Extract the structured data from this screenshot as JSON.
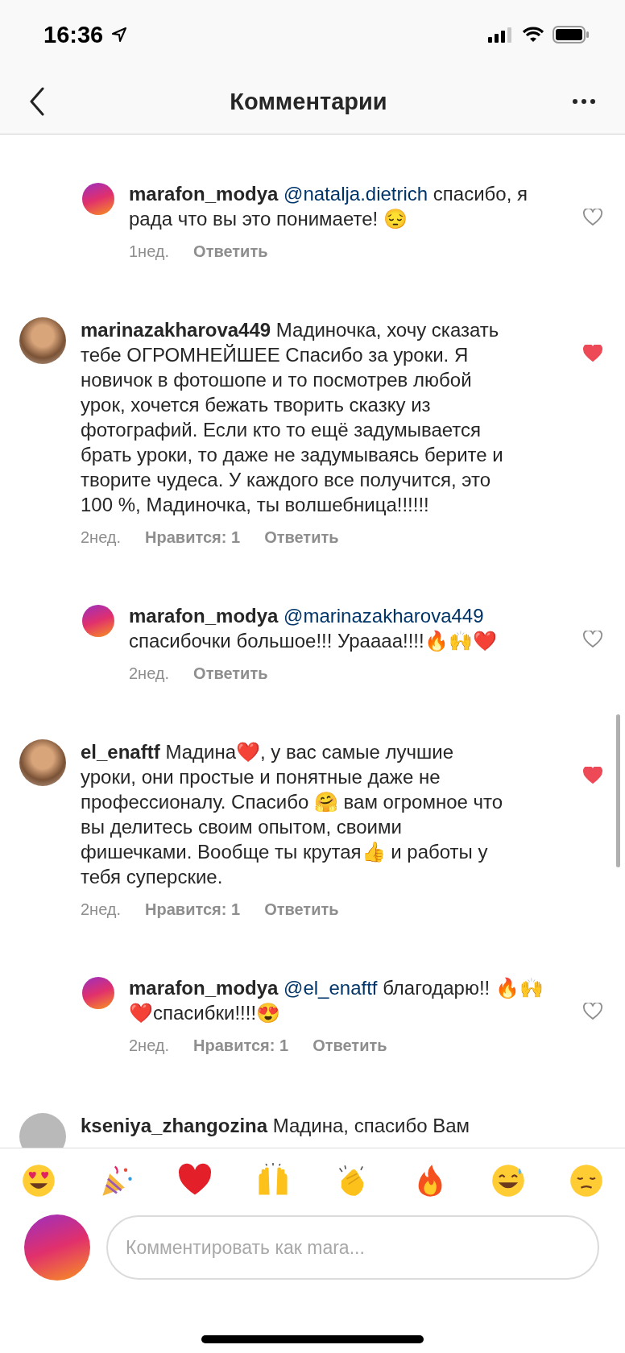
{
  "status_bar": {
    "time": "16:36"
  },
  "header": {
    "title": "Комментарии"
  },
  "comments": [
    {
      "kind": "reply",
      "username": "marafon_modya",
      "mention": "@natalja.dietrich",
      "text": "спасибо, я рада что вы это понимаете! 😔",
      "time": "1нед.",
      "reply": "Ответить",
      "liked": false
    },
    {
      "kind": "main",
      "username": "marinazakharova449",
      "text": "Мадиночка, хочу сказать тебе ОГРОМНЕЙШЕЕ Спасибо за уроки. Я  новичок в фотошопе и то посмотрев любой урок, хочется бежать творить сказку из фотографий. Если кто то ещё задумывается брать уроки, то даже не задумываясь берите и творите чудеса. У каждого все получится, это 100 %, Мадиночка, ты волшебница!!!!!!",
      "time": "2нед.",
      "likes": "Нравится: 1",
      "reply": "Ответить",
      "liked": true
    },
    {
      "kind": "reply",
      "username": "marafon_modya",
      "mention": "@marinazakharova449",
      "text": "спасибочки большое!!! Ураааа!!!!🔥🙌❤️",
      "time": "2нед.",
      "reply": "Ответить",
      "liked": false
    },
    {
      "kind": "main",
      "username": "el_enaftf",
      "text": "Мадина❤️, у вас самые лучшие уроки, они простые и понятные даже не профессионалу. Спасибо 🤗 вам огромное что вы делитесь своим опытом, своими фишечками. Вообще ты крутая👍 и работы у тебя суперские.",
      "time": "2нед.",
      "likes": "Нравится: 1",
      "reply": "Ответить",
      "liked": true
    },
    {
      "kind": "reply",
      "username": "marafon_modya",
      "mention": "@el_enaftf",
      "text": "благодарю!! 🔥🙌❤️спасибки!!!!😍",
      "time": "2нед.",
      "likes": "Нравится: 1",
      "reply": "Ответить",
      "liked": false
    },
    {
      "kind": "partial",
      "username": "kseniya_zhangozina",
      "text": "Мадина, спасибо Вам"
    }
  ],
  "emoji_bar": [
    {
      "kind": "heart-eyes"
    },
    {
      "kind": "party"
    },
    {
      "kind": "heart"
    },
    {
      "kind": "raised-hands"
    },
    {
      "kind": "clap"
    },
    {
      "kind": "fire"
    },
    {
      "kind": "sweat-smile"
    },
    {
      "kind": "pensive"
    }
  ],
  "composer": {
    "placeholder": "Комментировать как mara..."
  }
}
